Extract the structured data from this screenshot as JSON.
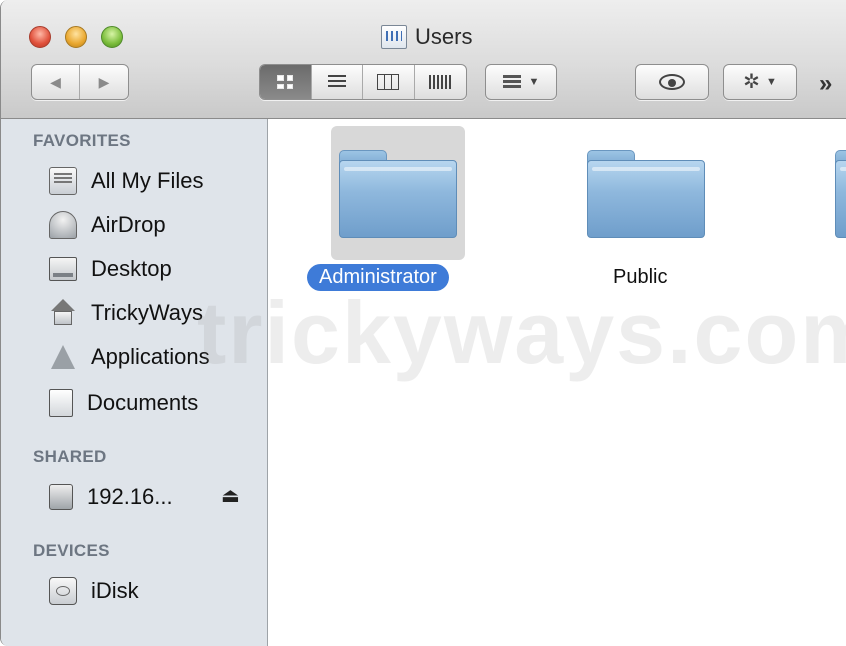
{
  "window": {
    "title": "Users"
  },
  "toolbar": {
    "back_label": "◀",
    "forward_label": "▶",
    "more_label": "»"
  },
  "sidebar": {
    "favorites_header": "FAVORITES",
    "favorites": [
      {
        "label": "All My Files",
        "icon": "all-my-files-icon"
      },
      {
        "label": "AirDrop",
        "icon": "airdrop-icon"
      },
      {
        "label": "Desktop",
        "icon": "desktop-icon"
      },
      {
        "label": "TrickyWays",
        "icon": "home-icon"
      },
      {
        "label": "Applications",
        "icon": "applications-icon"
      },
      {
        "label": "Documents",
        "icon": "documents-icon"
      }
    ],
    "shared_header": "SHARED",
    "shared": [
      {
        "label": "192.16...",
        "icon": "network-computer-icon",
        "eject": "⏏"
      }
    ],
    "devices_header": "DEVICES",
    "devices": [
      {
        "label": "iDisk",
        "icon": "idisk-icon"
      }
    ]
  },
  "content": {
    "items": [
      {
        "name": "Administrator",
        "selected": true
      },
      {
        "name": "Public",
        "selected": false
      }
    ]
  },
  "watermark": "trickyways.com",
  "colors": {
    "selection": "#3e7bd8",
    "sidebar_bg": "#dfe4ea",
    "folder_blue": "#8fb8dd"
  }
}
